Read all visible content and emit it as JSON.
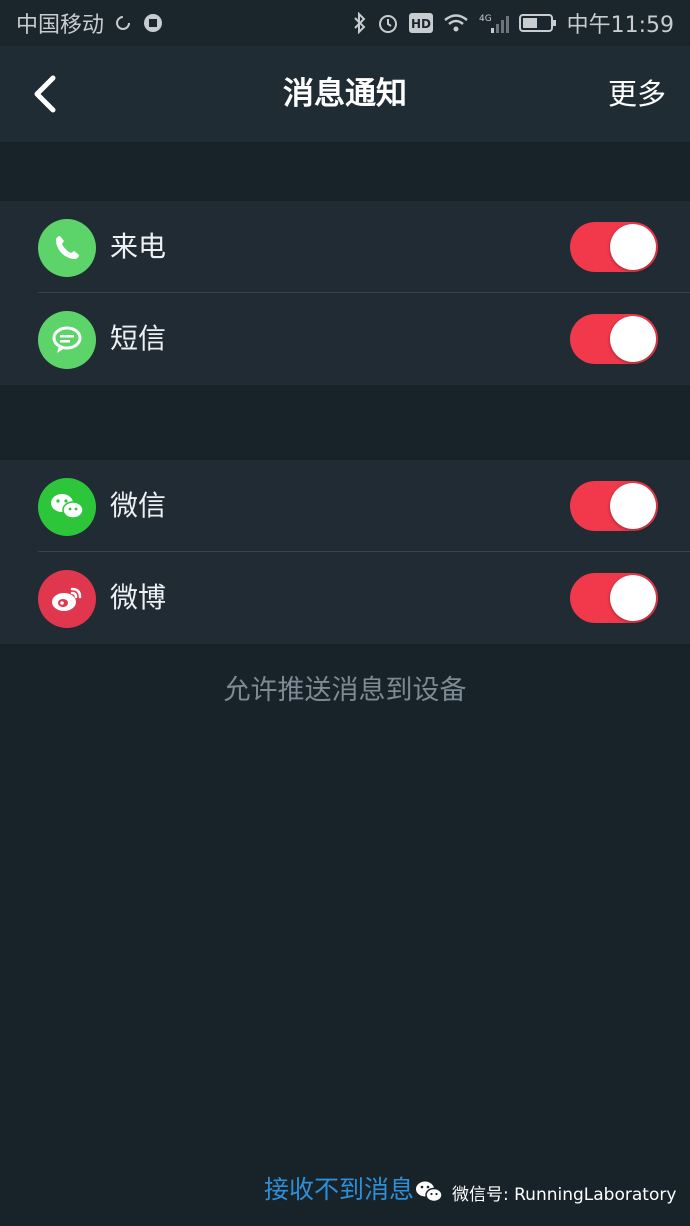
{
  "status_bar": {
    "carrier": "中国移动",
    "time": "中午11:59",
    "network": "4G",
    "hd_badge": "HD",
    "icons": [
      "sync-icon",
      "app-icon",
      "bluetooth-icon",
      "alarm-icon",
      "hd-icon",
      "wifi-icon",
      "signal-icon",
      "battery-icon"
    ]
  },
  "nav": {
    "title": "消息通知",
    "back_icon": "chevron-left-icon",
    "more_label": "更多"
  },
  "groups": [
    {
      "items": [
        {
          "label": "来电",
          "icon": "phone-icon",
          "icon_color": "#5dd46a",
          "enabled": true
        },
        {
          "label": "短信",
          "icon": "message-icon",
          "icon_color": "#5dd46a",
          "enabled": true
        }
      ]
    },
    {
      "items": [
        {
          "label": "微信",
          "icon": "wechat-icon",
          "icon_color": "#2dc63a",
          "enabled": true
        },
        {
          "label": "微博",
          "icon": "weibo-icon",
          "icon_color": "#e0364e",
          "enabled": true
        }
      ]
    }
  ],
  "hint": "允许推送消息到设备",
  "footer": {
    "link_label": "接收不到消息",
    "watermark_text": "微信号: RunningLaboratory"
  },
  "colors": {
    "toggle_on": "#f1394b",
    "background": "#172229",
    "panel": "#202b33",
    "link": "#2f8fd6"
  }
}
